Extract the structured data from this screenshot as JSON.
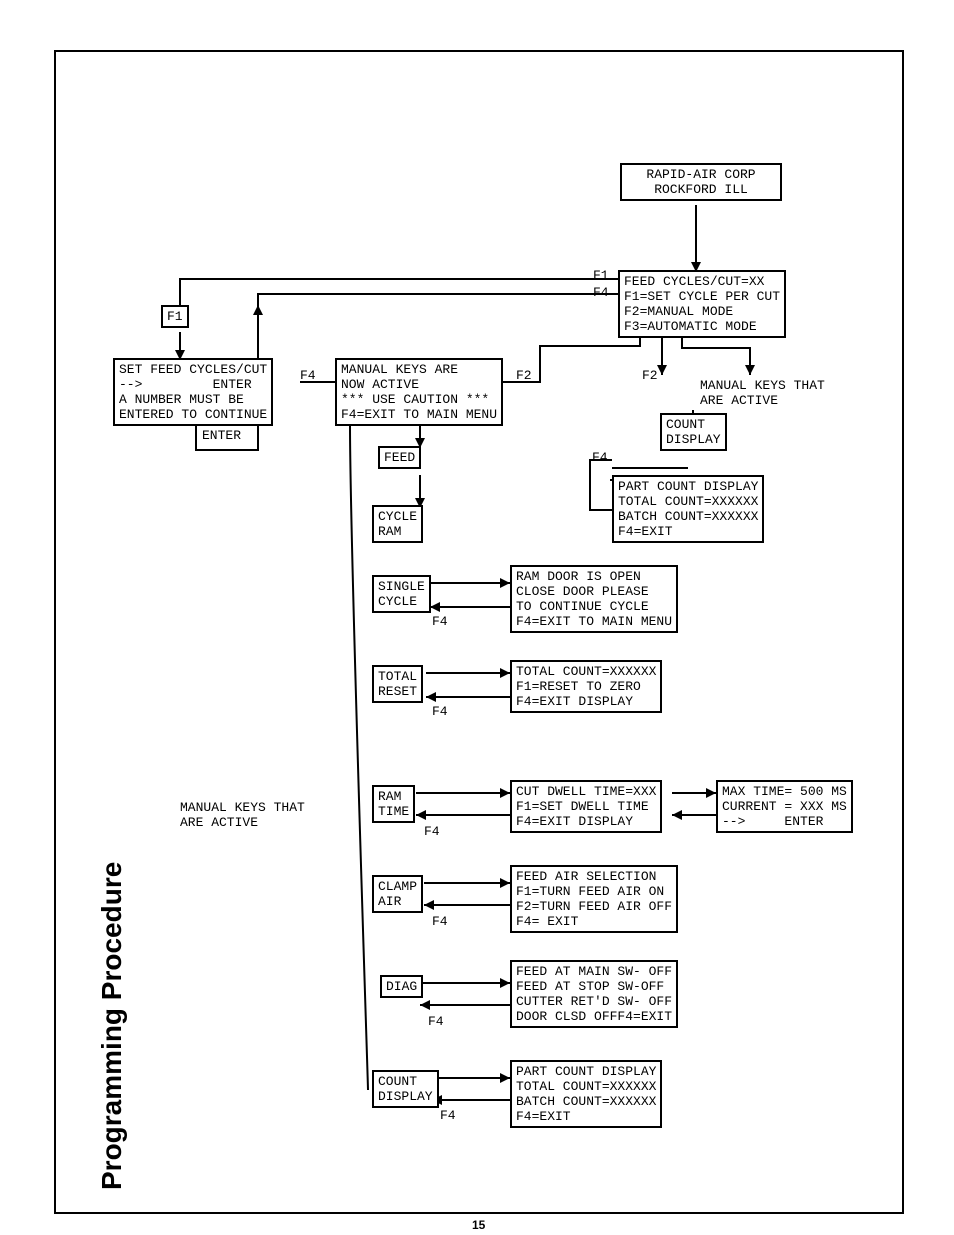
{
  "title": "Programming Procedure",
  "page_number": "15",
  "boxes": {
    "company": "RAPID-AIR CORP\nROCKFORD ILL",
    "main_menu": "FEED CYCLES/CUT=XX\nF1=SET CYCLE PER CUT\nF2=MANUAL MODE\nF3=AUTOMATIC MODE",
    "f1_box": "F1",
    "set_feed": "SET FEED CYCLES/CUT\n-->         ENTER\nA NUMBER MUST BE\nENTERED TO CONTINUE",
    "manual_keys": "MANUAL KEYS ARE\nNOW ACTIVE\n*** USE CAUTION ***\nF4=EXIT TO MAIN MENU",
    "feed": "FEED",
    "cycle_ram": "CYCLE\nRAM",
    "single_cycle": "SINGLE\nCYCLE",
    "total_reset": "TOTAL\nRESET",
    "ram_time": "RAM\nTIME",
    "clamp_air": "CLAMP\nAIR",
    "diag": "DIAG",
    "count_display": "COUNT\nDISPLAY",
    "count_display2": "COUNT\nDISPLAY",
    "ram_door": "RAM DOOR IS OPEN\nCLOSE DOOR PLEASE\nTO CONTINUE CYCLE\nF4=EXIT TO MAIN MENU",
    "total_count": "TOTAL COUNT=XXXXXX\nF1=RESET TO ZERO\nF4=EXIT DISPLAY",
    "cut_dwell": "CUT DWELL TIME=XXX\nF1=SET DWELL TIME\nF4=EXIT DISPLAY",
    "max_time": "MAX TIME= 500 MS\nCURRENT = XXX MS\n-->     ENTER",
    "feed_air": "FEED AIR SELECTION\nF1=TURN FEED AIR ON\nF2=TURN FEED AIR OFF\nF4= EXIT",
    "diag_out": "FEED AT MAIN SW- OFF\nFEED AT STOP SW-OFF\nCUTTER RET'D SW- OFF\nDOOR CLSD OFFF4=EXIT",
    "part_count": "PART COUNT DISPLAY\nTOTAL COUNT=XXXXXX\nBATCH COUNT=XXXXXX\nF4=EXIT",
    "part_count2": "PART COUNT DISPLAY\nTOTAL COUNT=XXXXXX\nBATCH COUNT=XXXXXX\nF4=EXIT"
  },
  "labels": {
    "manual_active_top": "MANUAL KEYS THAT\nARE ACTIVE",
    "manual_active_left": "MANUAL KEYS THAT\nARE ACTIVE",
    "f1": "F1",
    "f2a": "F2",
    "f2b": "F2",
    "f4_left": "F4",
    "f4_a": "F4",
    "f4_b": "F4",
    "f4_c": "F4",
    "f4_d": "F4",
    "f4_e": "F4",
    "f4_f": "F4",
    "f4_g": "F4",
    "f4_h": "F4",
    "enter": "ENTER"
  }
}
